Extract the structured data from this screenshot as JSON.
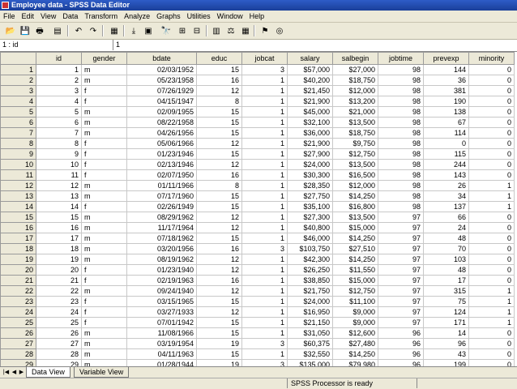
{
  "window": {
    "title": "Employee data - SPSS Data Editor"
  },
  "menu": [
    "File",
    "Edit",
    "View",
    "Data",
    "Transform",
    "Analyze",
    "Graphs",
    "Utilities",
    "Window",
    "Help"
  ],
  "toolbar": {
    "icons": [
      "open-folder-icon",
      "save-icon",
      "print-icon",
      "dialog-recall-icon",
      "undo-icon",
      "redo-icon",
      "goto-chart-icon",
      "goto-case-icon",
      "variables-icon",
      "find-icon",
      "insert-cases-icon",
      "insert-variable-icon",
      "split-file-icon",
      "weight-cases-icon",
      "select-cases-icon",
      "value-labels-icon",
      "use-sets-icon"
    ],
    "glyphs": [
      "📂",
      "💾",
      "🖶",
      "▤",
      "↶",
      "↷",
      "▦",
      "⤓",
      "▣",
      "🔭",
      "⊞",
      "⊟",
      "▥",
      "⚖",
      "▦",
      "⚑",
      "◎"
    ]
  },
  "cell_editor": {
    "ref": "1 : id",
    "value": "1"
  },
  "columns": [
    "id",
    "gender",
    "bdate",
    "educ",
    "jobcat",
    "salary",
    "salbegin",
    "jobtime",
    "prevexp",
    "minority"
  ],
  "rows": [
    [
      "1",
      "1",
      "m",
      "02/03/1952",
      "15",
      "3",
      "$57,000",
      "$27,000",
      "98",
      "144",
      "0"
    ],
    [
      "2",
      "2",
      "m",
      "05/23/1958",
      "16",
      "1",
      "$40,200",
      "$18,750",
      "98",
      "36",
      "0"
    ],
    [
      "3",
      "3",
      "f",
      "07/26/1929",
      "12",
      "1",
      "$21,450",
      "$12,000",
      "98",
      "381",
      "0"
    ],
    [
      "4",
      "4",
      "f",
      "04/15/1947",
      "8",
      "1",
      "$21,900",
      "$13,200",
      "98",
      "190",
      "0"
    ],
    [
      "5",
      "5",
      "m",
      "02/09/1955",
      "15",
      "1",
      "$45,000",
      "$21,000",
      "98",
      "138",
      "0"
    ],
    [
      "6",
      "6",
      "m",
      "08/22/1958",
      "15",
      "1",
      "$32,100",
      "$13,500",
      "98",
      "67",
      "0"
    ],
    [
      "7",
      "7",
      "m",
      "04/26/1956",
      "15",
      "1",
      "$36,000",
      "$18,750",
      "98",
      "114",
      "0"
    ],
    [
      "8",
      "8",
      "f",
      "05/06/1966",
      "12",
      "1",
      "$21,900",
      "$9,750",
      "98",
      "0",
      "0"
    ],
    [
      "9",
      "9",
      "f",
      "01/23/1946",
      "15",
      "1",
      "$27,900",
      "$12,750",
      "98",
      "115",
      "0"
    ],
    [
      "10",
      "10",
      "f",
      "02/13/1946",
      "12",
      "1",
      "$24,000",
      "$13,500",
      "98",
      "244",
      "0"
    ],
    [
      "11",
      "11",
      "f",
      "02/07/1950",
      "16",
      "1",
      "$30,300",
      "$16,500",
      "98",
      "143",
      "0"
    ],
    [
      "12",
      "12",
      "m",
      "01/11/1966",
      "8",
      "1",
      "$28,350",
      "$12,000",
      "98",
      "26",
      "1"
    ],
    [
      "13",
      "13",
      "m",
      "07/17/1960",
      "15",
      "1",
      "$27,750",
      "$14,250",
      "98",
      "34",
      "1"
    ],
    [
      "14",
      "14",
      "f",
      "02/26/1949",
      "15",
      "1",
      "$35,100",
      "$16,800",
      "98",
      "137",
      "1"
    ],
    [
      "15",
      "15",
      "m",
      "08/29/1962",
      "12",
      "1",
      "$27,300",
      "$13,500",
      "97",
      "66",
      "0"
    ],
    [
      "16",
      "16",
      "m",
      "11/17/1964",
      "12",
      "1",
      "$40,800",
      "$15,000",
      "97",
      "24",
      "0"
    ],
    [
      "17",
      "17",
      "m",
      "07/18/1962",
      "15",
      "1",
      "$46,000",
      "$14,250",
      "97",
      "48",
      "0"
    ],
    [
      "18",
      "18",
      "m",
      "03/20/1956",
      "16",
      "3",
      "$103,750",
      "$27,510",
      "97",
      "70",
      "0"
    ],
    [
      "19",
      "19",
      "m",
      "08/19/1962",
      "12",
      "1",
      "$42,300",
      "$14,250",
      "97",
      "103",
      "0"
    ],
    [
      "20",
      "20",
      "f",
      "01/23/1940",
      "12",
      "1",
      "$26,250",
      "$11,550",
      "97",
      "48",
      "0"
    ],
    [
      "21",
      "21",
      "f",
      "02/19/1963",
      "16",
      "1",
      "$38,850",
      "$15,000",
      "97",
      "17",
      "0"
    ],
    [
      "22",
      "22",
      "m",
      "09/24/1940",
      "12",
      "1",
      "$21,750",
      "$12,750",
      "97",
      "315",
      "1"
    ],
    [
      "23",
      "23",
      "f",
      "03/15/1965",
      "15",
      "1",
      "$24,000",
      "$11,100",
      "97",
      "75",
      "1"
    ],
    [
      "24",
      "24",
      "f",
      "03/27/1933",
      "12",
      "1",
      "$16,950",
      "$9,000",
      "97",
      "124",
      "1"
    ],
    [
      "25",
      "25",
      "f",
      "07/01/1942",
      "15",
      "1",
      "$21,150",
      "$9,000",
      "97",
      "171",
      "1"
    ],
    [
      "26",
      "26",
      "m",
      "11/08/1966",
      "15",
      "1",
      "$31,050",
      "$12,600",
      "96",
      "14",
      "0"
    ],
    [
      "27",
      "27",
      "m",
      "03/19/1954",
      "19",
      "3",
      "$60,375",
      "$27,480",
      "96",
      "96",
      "0"
    ],
    [
      "28",
      "28",
      "m",
      "04/11/1963",
      "15",
      "1",
      "$32,550",
      "$14,250",
      "96",
      "43",
      "0"
    ],
    [
      "29",
      "29",
      "m",
      "01/28/1944",
      "19",
      "3",
      "$135,000",
      "$79,980",
      "96",
      "199",
      "0"
    ],
    [
      "30",
      "30",
      "m",
      "09/17/1951",
      "15",
      "1",
      "$31,200",
      "$14,250",
      "96",
      "54",
      "0"
    ]
  ],
  "tabs": {
    "data_view": "Data View",
    "variable_view": "Variable View"
  },
  "nav": {
    "first": "|◀",
    "prev": "◀",
    "next": "▶",
    "last": "▶|"
  },
  "status": {
    "processor": "SPSS Processor  is ready"
  },
  "colors": {
    "title_bar": "#1a3f99",
    "chrome": "#ece9d8"
  }
}
